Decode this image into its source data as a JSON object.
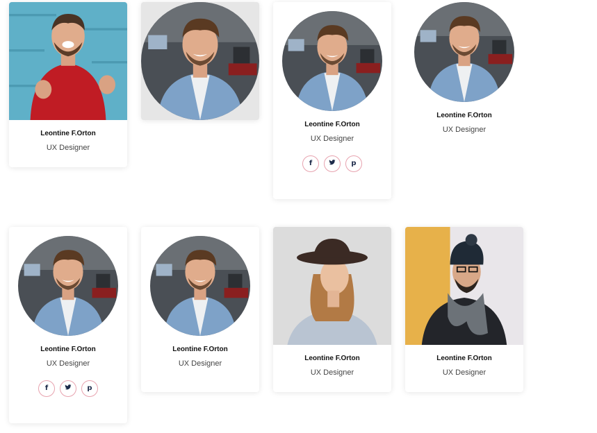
{
  "cards": [
    {
      "name": "Leontine F.Orton",
      "role": "UX Designer",
      "photo": "man-red-sweater-photo"
    },
    {
      "name": "",
      "role": "",
      "photo": "man-denim-shirt-photo"
    },
    {
      "name": "Leontine F.Orton",
      "role": "UX Designer",
      "photo": "man-denim-shirt-photo",
      "socials": [
        "facebook-icon",
        "twitter-icon",
        "pinterest-icon"
      ]
    },
    {
      "name": "Leontine F.Orton",
      "role": "UX Designer",
      "photo": "man-denim-shirt-photo"
    },
    {
      "name": "Leontine F.Orton",
      "role": "UX Designer",
      "photo": "man-denim-shirt-photo",
      "socials": [
        "facebook-icon",
        "twitter-icon",
        "pinterest-icon"
      ]
    },
    {
      "name": "Leontine F.Orton",
      "role": "UX Designer",
      "photo": "man-denim-shirt-photo"
    },
    {
      "name": "Leontine F.Orton",
      "role": "UX Designer",
      "photo": "woman-hat-photo"
    },
    {
      "name": "Leontine F.Orton",
      "role": "UX Designer",
      "photo": "man-beanie-scarf-photo"
    }
  ],
  "social_glyphs": {
    "facebook": "f",
    "pinterest": "p"
  },
  "colors": {
    "social_border": "#e7a2ae",
    "social_icon": "#1d2b4a",
    "card_bg": "#ffffff"
  }
}
